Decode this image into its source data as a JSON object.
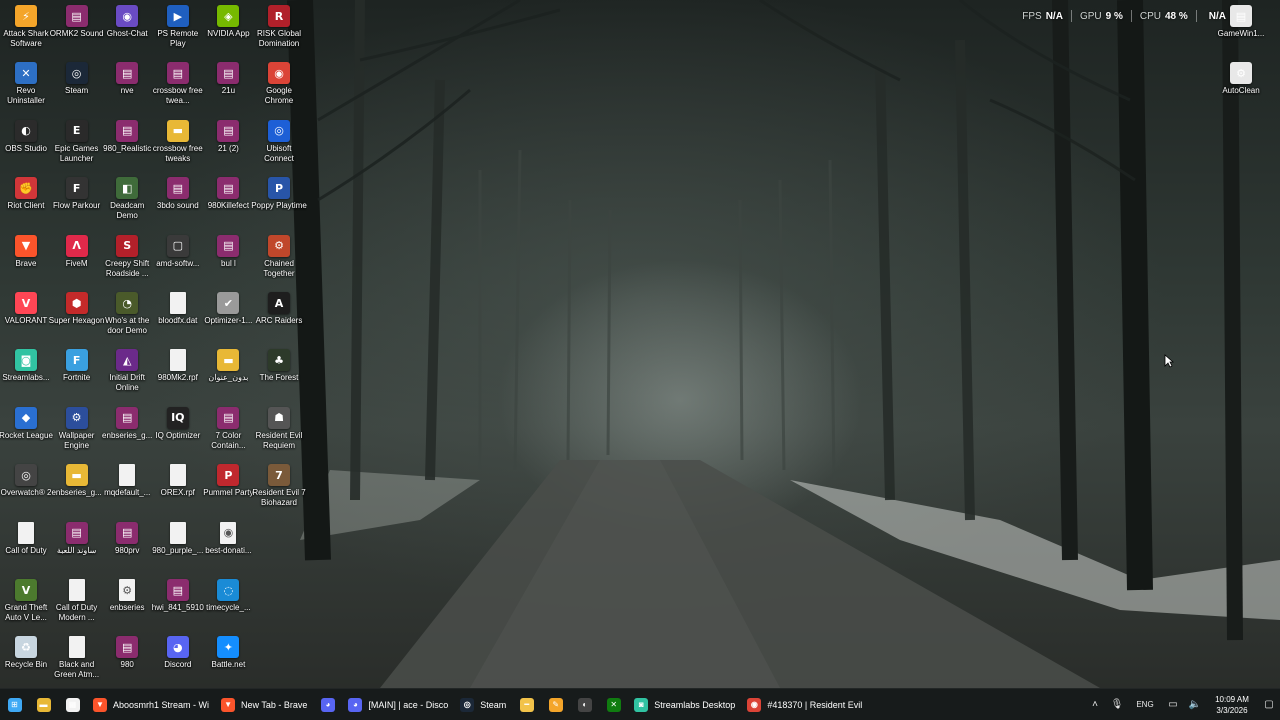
{
  "overlay": {
    "fps_label": "FPS",
    "fps_value": "N/A",
    "gpu_label": "GPU",
    "gpu_value": "9 %",
    "cpu_label": "CPU",
    "cpu_value": "48 %",
    "extra_value": "N/A"
  },
  "desktop_icons": [
    {
      "label": "Attack Shark Software",
      "icon": "attack-shark-icon",
      "color": "#f4a52a",
      "glyph": "⚡",
      "col": 0,
      "row": 0
    },
    {
      "label": "ORMK2 Sound",
      "icon": "winrar-icon",
      "color": "#8b2c6e",
      "glyph": "▤",
      "col": 1,
      "row": 0
    },
    {
      "label": "Ghost-Chat",
      "icon": "ghost-chat-icon",
      "color": "#6a4bc4",
      "glyph": "◉",
      "col": 2,
      "row": 0
    },
    {
      "label": "PS Remote Play",
      "icon": "ps-remote-play-icon",
      "color": "#1f5fbf",
      "glyph": "▶",
      "col": 3,
      "row": 0
    },
    {
      "label": "NVIDIA App",
      "icon": "nvidia-icon",
      "color": "#76b900",
      "glyph": "◈",
      "col": 4,
      "row": 0
    },
    {
      "label": "RISK Global Domination",
      "icon": "risk-icon",
      "color": "#b0202a",
      "glyph": "R",
      "col": 5,
      "row": 0
    },
    {
      "label": "Revo Uninstaller",
      "icon": "revo-uninstaller-icon",
      "color": "#2d6fc4",
      "glyph": "✕",
      "col": 0,
      "row": 1
    },
    {
      "label": "Steam",
      "icon": "steam-icon",
      "color": "#1b2838",
      "glyph": "◎",
      "col": 1,
      "row": 1
    },
    {
      "label": "nve",
      "icon": "winrar-icon",
      "color": "#8b2c6e",
      "glyph": "▤",
      "col": 2,
      "row": 1
    },
    {
      "label": "crossbow free twea...",
      "icon": "winrar-icon",
      "color": "#8b2c6e",
      "glyph": "▤",
      "col": 3,
      "row": 1
    },
    {
      "label": "21u",
      "icon": "winrar-icon",
      "color": "#8b2c6e",
      "glyph": "▤",
      "col": 4,
      "row": 1
    },
    {
      "label": "Google Chrome",
      "icon": "chrome-icon",
      "color": "#db4437",
      "glyph": "◉",
      "col": 5,
      "row": 1
    },
    {
      "label": "OBS Studio",
      "icon": "obs-icon",
      "color": "#2b2b2b",
      "glyph": "◐",
      "col": 0,
      "row": 2
    },
    {
      "label": "Epic Games Launcher",
      "icon": "epic-games-icon",
      "color": "#2a2a2a",
      "glyph": "E",
      "col": 1,
      "row": 2
    },
    {
      "label": "980_Realistic",
      "icon": "winrar-icon",
      "color": "#8b2c6e",
      "glyph": "▤",
      "col": 2,
      "row": 2
    },
    {
      "label": "crossbow free tweaks",
      "icon": "folder-icon",
      "color": "#e8b836",
      "glyph": "▬",
      "col": 3,
      "row": 2
    },
    {
      "label": "21 (2)",
      "icon": "winrar-icon",
      "color": "#8b2c6e",
      "glyph": "▤",
      "col": 4,
      "row": 2
    },
    {
      "label": "Ubisoft Connect",
      "icon": "ubisoft-icon",
      "color": "#1d5fd6",
      "glyph": "◎",
      "col": 5,
      "row": 2
    },
    {
      "label": "Riot Client",
      "icon": "riot-client-icon",
      "color": "#d13639",
      "glyph": "✊",
      "col": 0,
      "row": 3
    },
    {
      "label": "Flow Parkour",
      "icon": "flow-parkour-icon",
      "color": "#333333",
      "glyph": "F",
      "col": 1,
      "row": 3
    },
    {
      "label": "Deadcam Demo",
      "icon": "deadcam-icon",
      "color": "#3f6b3a",
      "glyph": "◧",
      "col": 2,
      "row": 3
    },
    {
      "label": "3bdo sound",
      "icon": "winrar-icon",
      "color": "#8b2c6e",
      "glyph": "▤",
      "col": 3,
      "row": 3
    },
    {
      "label": "980Killefect",
      "icon": "winrar-icon",
      "color": "#8b2c6e",
      "glyph": "▤",
      "col": 4,
      "row": 3
    },
    {
      "label": "Poppy Playtime",
      "icon": "poppy-playtime-icon",
      "color": "#2855a8",
      "glyph": "P",
      "col": 5,
      "row": 3
    },
    {
      "label": "Brave",
      "icon": "brave-icon",
      "color": "#fb542b",
      "glyph": "▼",
      "col": 0,
      "row": 4
    },
    {
      "label": "FiveM",
      "icon": "fivem-icon",
      "color": "#e0294a",
      "glyph": "Λ",
      "col": 1,
      "row": 4
    },
    {
      "label": "Creepy Shift Roadside ...",
      "icon": "creepy-shift-icon",
      "color": "#b3202a",
      "glyph": "S",
      "col": 2,
      "row": 4
    },
    {
      "label": "amd-softw...",
      "icon": "amd-software-icon",
      "color": "#3a3a3a",
      "glyph": "▢",
      "col": 3,
      "row": 4
    },
    {
      "label": "bul l",
      "icon": "winrar-icon",
      "color": "#8b2c6e",
      "glyph": "▤",
      "col": 4,
      "row": 4
    },
    {
      "label": "Chained Together",
      "icon": "chained-together-icon",
      "color": "#c0472b",
      "glyph": "⚙",
      "col": 5,
      "row": 4
    },
    {
      "label": "VALORANT",
      "icon": "valorant-icon",
      "color": "#ff4655",
      "glyph": "V",
      "col": 0,
      "row": 5
    },
    {
      "label": "Super Hexagon",
      "icon": "super-hexagon-icon",
      "color": "#c42a2a",
      "glyph": "⬢",
      "col": 1,
      "row": 5
    },
    {
      "label": "Who's at the door Demo",
      "icon": "whos-at-the-door-icon",
      "color": "#4a5a2a",
      "glyph": "◔",
      "col": 2,
      "row": 5
    },
    {
      "label": "bloodfx.dat",
      "icon": "file-icon",
      "color": "#f2f2f2",
      "glyph": "",
      "col": 3,
      "row": 5
    },
    {
      "label": "Optimizer-1...",
      "icon": "optimizer-icon",
      "color": "#9a9a9a",
      "glyph": "✔",
      "col": 4,
      "row": 5
    },
    {
      "label": "ARC Raiders",
      "icon": "arc-raiders-icon",
      "color": "#1e1e1e",
      "glyph": "A",
      "col": 5,
      "row": 5
    },
    {
      "label": "Streamlabs...",
      "icon": "streamlabs-icon",
      "color": "#31c3a2",
      "glyph": "◙",
      "col": 0,
      "row": 6
    },
    {
      "label": "Fortnite",
      "icon": "fortnite-icon",
      "color": "#3aa0e0",
      "glyph": "F",
      "col": 1,
      "row": 6
    },
    {
      "label": "Initial Drift Online",
      "icon": "initial-drift-icon",
      "color": "#6b2a8a",
      "glyph": "◭",
      "col": 2,
      "row": 6
    },
    {
      "label": "980Mk2.rpf",
      "icon": "file-icon",
      "color": "#f2f2f2",
      "glyph": "",
      "col": 3,
      "row": 6
    },
    {
      "label": "بدون_عنوان",
      "icon": "folder-icon",
      "color": "#e8b836",
      "glyph": "▬",
      "col": 4,
      "row": 6
    },
    {
      "label": "The Forest",
      "icon": "the-forest-icon",
      "color": "#2d3a2a",
      "glyph": "♣",
      "col": 5,
      "row": 6
    },
    {
      "label": "Rocket League",
      "icon": "rocket-league-icon",
      "color": "#2a6fd1",
      "glyph": "◆",
      "col": 0,
      "row": 7
    },
    {
      "label": "Wallpaper Engine",
      "icon": "wallpaper-engine-icon",
      "color": "#2c4e9c",
      "glyph": "⚙",
      "col": 1,
      "row": 7
    },
    {
      "label": "enbseries_g...",
      "icon": "winrar-icon",
      "color": "#8b2c6e",
      "glyph": "▤",
      "col": 2,
      "row": 7
    },
    {
      "label": "IQ Optimizer",
      "icon": "iq-optimizer-icon",
      "color": "#222222",
      "glyph": "IQ",
      "col": 3,
      "row": 7
    },
    {
      "label": "7 Color Contain...",
      "icon": "winrar-icon",
      "color": "#8b2c6e",
      "glyph": "▤",
      "col": 4,
      "row": 7
    },
    {
      "label": "Resident Evil Requiem",
      "icon": "resident-evil-requiem-icon",
      "color": "#555555",
      "glyph": "☗",
      "col": 5,
      "row": 7
    },
    {
      "label": "Overwatch® 2",
      "icon": "overwatch-icon",
      "color": "#444444",
      "glyph": "◎",
      "col": 0,
      "row": 8
    },
    {
      "label": "enbseries_g...",
      "icon": "folder-icon",
      "color": "#e8b836",
      "glyph": "▬",
      "col": 1,
      "row": 8
    },
    {
      "label": "mqdefault_...",
      "icon": "file-icon",
      "color": "#f2f2f2",
      "glyph": "",
      "col": 2,
      "row": 8
    },
    {
      "label": "OREX.rpf",
      "icon": "file-icon",
      "color": "#f2f2f2",
      "glyph": "",
      "col": 3,
      "row": 8
    },
    {
      "label": "Pummel Party",
      "icon": "pummel-party-icon",
      "color": "#c0282e",
      "glyph": "P",
      "col": 4,
      "row": 8
    },
    {
      "label": "Resident Evil 7 Biohazard",
      "icon": "resident-evil-7-icon",
      "color": "#7a5a3a",
      "glyph": "7",
      "col": 5,
      "row": 8
    },
    {
      "label": "Call of Duty",
      "icon": "file-icon",
      "color": "#f2f2f2",
      "glyph": "",
      "col": 0,
      "row": 9
    },
    {
      "label": "ساوند اللعبة",
      "icon": "winrar-icon",
      "color": "#8b2c6e",
      "glyph": "▤",
      "col": 1,
      "row": 9
    },
    {
      "label": "980prv",
      "icon": "winrar-icon",
      "color": "#8b2c6e",
      "glyph": "▤",
      "col": 2,
      "row": 9
    },
    {
      "label": "980_purple_...",
      "icon": "file-icon",
      "color": "#f2f2f2",
      "glyph": "",
      "col": 3,
      "row": 9
    },
    {
      "label": "best-donati...",
      "icon": "file-icon",
      "color": "#f2f2f2",
      "glyph": "◉",
      "col": 4,
      "row": 9
    },
    {
      "label": "Grand Theft Auto V Le...",
      "icon": "gta-v-icon",
      "color": "#4c7a2e",
      "glyph": "V",
      "col": 0,
      "row": 10
    },
    {
      "label": "Call of Duty Modern ...",
      "icon": "file-icon",
      "color": "#f2f2f2",
      "glyph": "",
      "col": 1,
      "row": 10
    },
    {
      "label": "enbseries",
      "icon": "file-icon",
      "color": "#f2f2f2",
      "glyph": "⚙",
      "col": 2,
      "row": 10
    },
    {
      "label": "hwi_841_5910",
      "icon": "winrar-icon",
      "color": "#8b2c6e",
      "glyph": "▤",
      "col": 3,
      "row": 10
    },
    {
      "label": "timecycle_...",
      "icon": "edge-icon",
      "color": "#1a8bd6",
      "glyph": "◌",
      "col": 4,
      "row": 10
    },
    {
      "label": "Recycle Bin",
      "icon": "recycle-bin-icon",
      "color": "#c8d6e0",
      "glyph": "♻",
      "col": 0,
      "row": 11
    },
    {
      "label": "Black and Green Atm...",
      "icon": "file-icon",
      "color": "#f2f2f2",
      "glyph": "",
      "col": 1,
      "row": 11
    },
    {
      "label": "980",
      "icon": "winrar-icon",
      "color": "#8b2c6e",
      "glyph": "▤",
      "col": 2,
      "row": 11
    },
    {
      "label": "Discord",
      "icon": "discord-icon",
      "color": "#5865f2",
      "glyph": "◕",
      "col": 3,
      "row": 11
    },
    {
      "label": "Battle.net",
      "icon": "battlenet-icon",
      "color": "#148eff",
      "glyph": "✦",
      "col": 4,
      "row": 11
    }
  ],
  "right_icons": [
    {
      "label": "GameWin1...",
      "icon": "gamewin-icon",
      "color": "#e8e8e8",
      "glyph": "▤",
      "col": 0,
      "row": 0
    },
    {
      "label": "AutoClean",
      "icon": "autoclean-icon",
      "color": "#e8e8e8",
      "glyph": "⚙",
      "col": 0,
      "row": 1
    }
  ],
  "taskbar": {
    "apps": [
      {
        "type": "icon",
        "name": "start-icon",
        "glyph": "⊞",
        "color": "#3fa9f5"
      },
      {
        "type": "icon",
        "name": "file-explorer-icon",
        "glyph": "▬",
        "color": "#e8b836"
      },
      {
        "type": "icon",
        "name": "microsoft-store-icon",
        "glyph": "▦",
        "color": "#f2f2f2"
      },
      {
        "type": "app",
        "name": "taskbar-brave-stream",
        "glyph": "▼",
        "color": "#fb542b",
        "label": "Aboosmrh1 Stream - Wi"
      },
      {
        "type": "app",
        "name": "taskbar-brave-newtab",
        "glyph": "▼",
        "color": "#fb542b",
        "label": "New Tab - Brave"
      },
      {
        "type": "icon",
        "name": "discord-icon",
        "glyph": "◕",
        "color": "#5865f2"
      },
      {
        "type": "app",
        "name": "taskbar-discord",
        "glyph": "◕",
        "color": "#5865f2",
        "label": "[MAIN] | ace - Disco"
      },
      {
        "type": "app",
        "name": "taskbar-steam",
        "glyph": "◎",
        "color": "#1b2838",
        "label": "Steam"
      },
      {
        "type": "icon",
        "name": "taskbar-misc-icon",
        "glyph": "━",
        "color": "#f2c34a"
      },
      {
        "type": "icon",
        "name": "taskbar-fl-icon",
        "glyph": "✎",
        "color": "#f4a52a"
      },
      {
        "type": "icon",
        "name": "taskbar-obs-icon",
        "glyph": "◐",
        "color": "#444444"
      },
      {
        "type": "icon",
        "name": "xbox-icon",
        "glyph": "✕",
        "color": "#107c10"
      },
      {
        "type": "app",
        "name": "taskbar-streamlabs",
        "glyph": "◙",
        "color": "#31c3a2",
        "label": "Streamlabs Desktop"
      },
      {
        "type": "app",
        "name": "taskbar-chrome",
        "glyph": "◉",
        "color": "#db4437",
        "label": "#418370 | Resident Evil"
      }
    ],
    "tray": {
      "language": "ENG",
      "time": "10:09 AM",
      "date": "3/3/2026"
    }
  }
}
